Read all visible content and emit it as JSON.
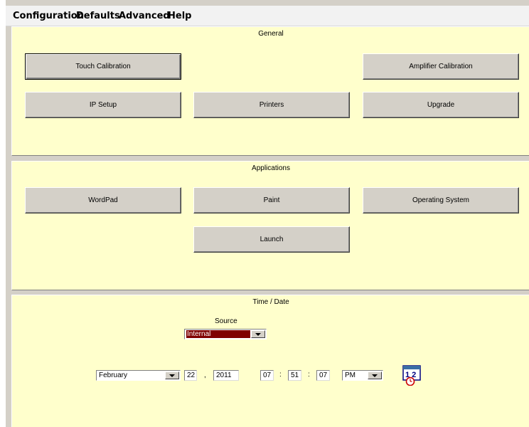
{
  "menu": [
    "Configuration",
    "Defaults",
    "Advanced",
    "Help"
  ],
  "general": {
    "title": "General",
    "touch_calibration": "Touch Calibration",
    "amplifier_calibration": "Amplifier Calibration",
    "ip_setup": "IP Setup",
    "printers": "Printers",
    "upgrade": "Upgrade"
  },
  "applications": {
    "title": "Applications",
    "wordpad": "WordPad",
    "paint": "Paint",
    "operating_system": "Operating System",
    "launch": "Launch"
  },
  "time_date": {
    "title": "Time / Date",
    "source_label": "Source",
    "source_value": "Internal",
    "month": "February",
    "day": "22",
    "year": "2011",
    "hour": "07",
    "minute": "51",
    "second": "07",
    "ampm": "PM",
    "date_sep": ",",
    "time_sep": ":",
    "clock_icon_text": "1 2"
  },
  "colors": {
    "panel_bg": "#ffffcc",
    "button_face": "#d4d0c8",
    "source_selected_bg": "#800000"
  }
}
